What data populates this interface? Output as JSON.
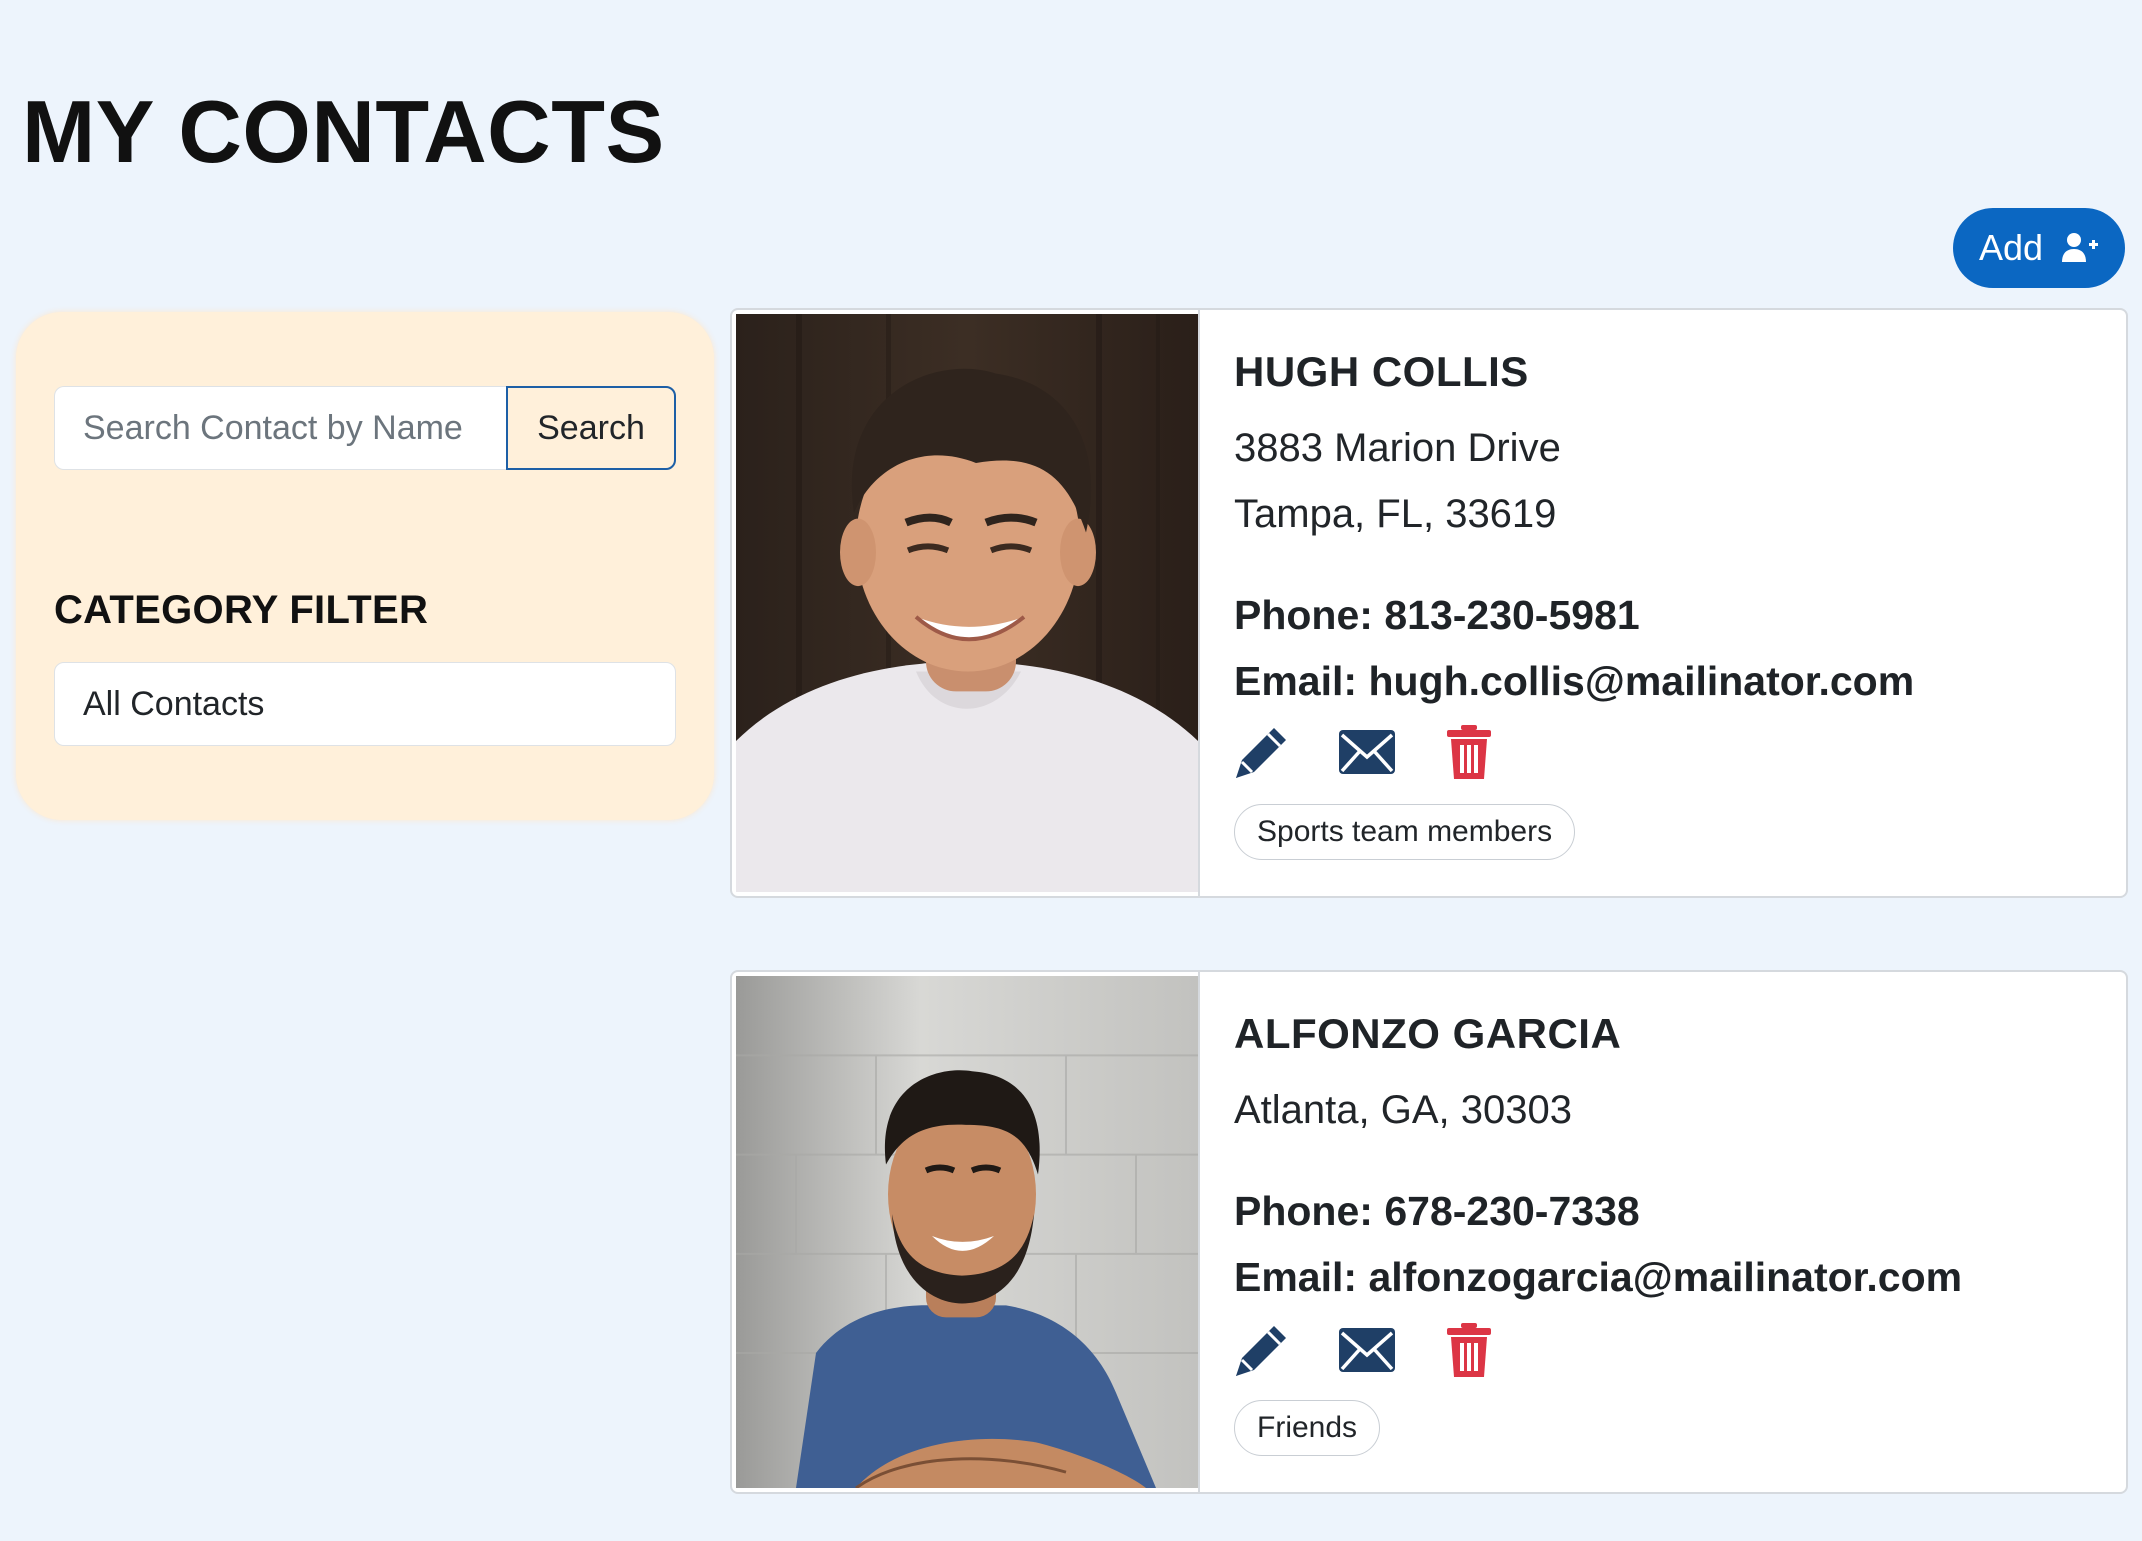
{
  "header": {
    "title": "MY CONTACTS",
    "add_label": "Add"
  },
  "sidebar": {
    "search_placeholder": "Search Contact by Name",
    "search_value": "",
    "search_button": "Search",
    "filter_heading": "CATEGORY FILTER",
    "filter_selected": "All Contacts"
  },
  "contacts": [
    {
      "name": "HUGH COLLIS",
      "address_line1": "3883 Marion Drive",
      "address_line2": "Tampa, FL, 33619",
      "phone_label": "Phone:",
      "phone": "813-230-5981",
      "email_label": "Email:",
      "email": "hugh.collis@mailinator.com",
      "category": "Sports team members"
    },
    {
      "name": "ALFONZO GARCIA",
      "address_line1": "Atlanta, GA, 30303",
      "phone_label": "Phone:",
      "phone": "678-230-7338",
      "email_label": "Email:",
      "email": "alfonzogarcia@mailinator.com",
      "category": "Friends"
    }
  ],
  "icons": {
    "add": "person-plus-icon",
    "edit": "pencil-icon",
    "email": "envelope-icon",
    "delete": "trash-icon"
  },
  "colors": {
    "page_bg": "#edf4fc",
    "primary": "#0b67c2",
    "sidebar_bg": "#fff0da",
    "icon_dark": "#1f3f66",
    "delete_red": "#dc3545"
  }
}
